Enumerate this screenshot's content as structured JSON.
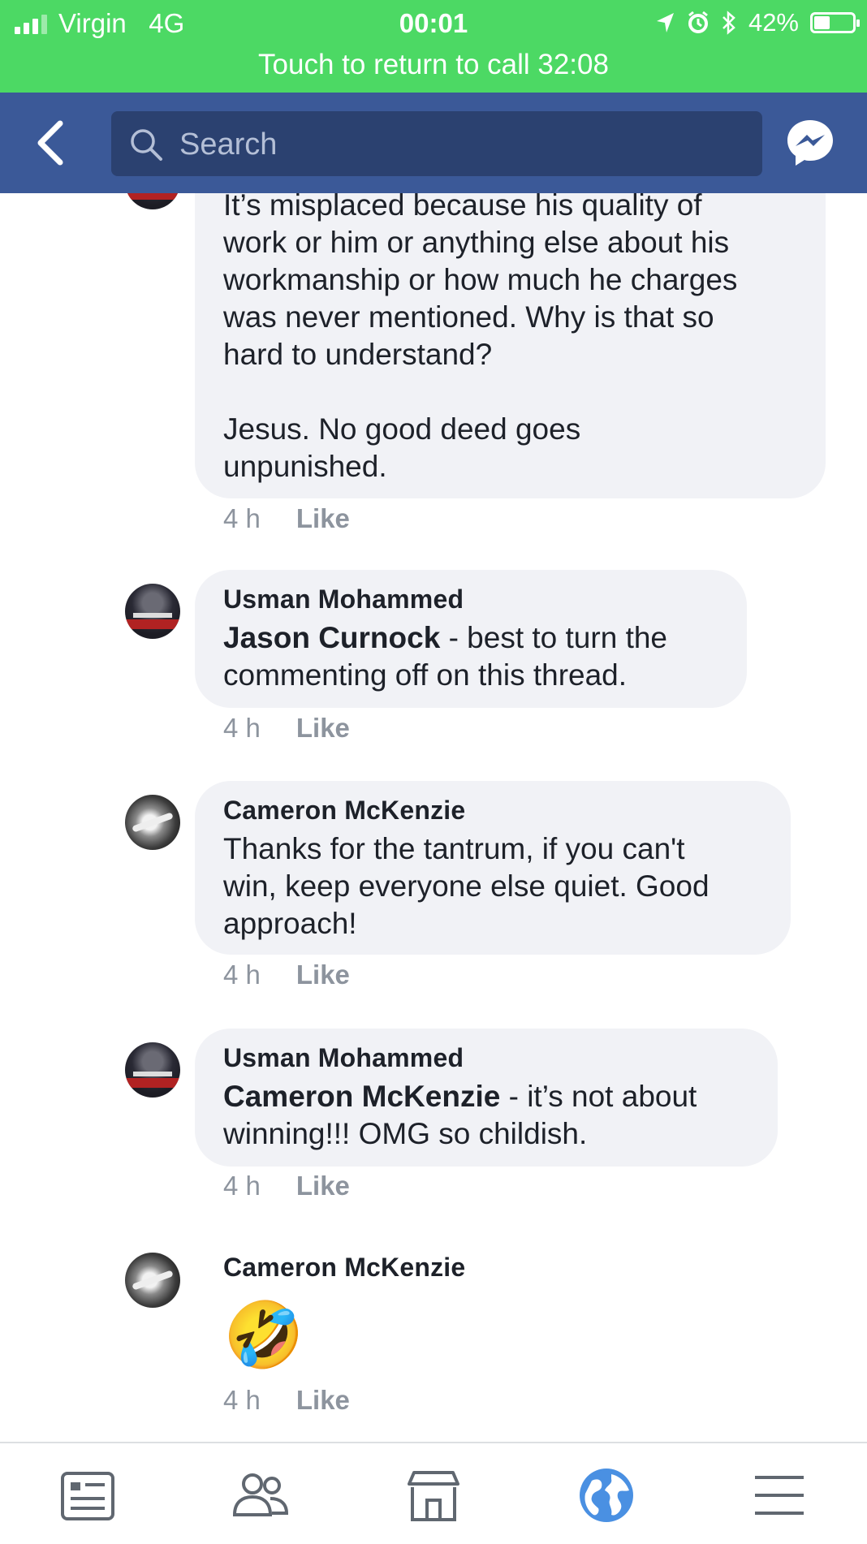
{
  "status_bar": {
    "carrier": "Virgin",
    "network": "4G",
    "time": "00:01",
    "battery": "42%",
    "battery_level": 0.42,
    "call_banner": "Touch to return to call 32:08",
    "icons": [
      "signal-icon",
      "location-arrow-icon",
      "alarm-icon",
      "bluetooth-icon",
      "battery-icon"
    ]
  },
  "nav": {
    "back_icon": "chevron-left-icon",
    "search_placeholder": "Search",
    "messenger_icon": "messenger-icon"
  },
  "comments": [
    {
      "author": "",
      "lines": [
        "It’s misplaced because his quality of",
        "work or him or anything else about his",
        "workmanship or how much he charges",
        "was never mentioned. Why is that so",
        "hard to understand?",
        "",
        "Jesus. No good deed goes",
        "unpunished."
      ],
      "time": "4 h",
      "like": "Like"
    },
    {
      "author": "Usman Mohammed",
      "mention": "Jason Curnock",
      "text_first": " - best to turn the",
      "text_rest": "commenting off on this thread.",
      "time": "4 h",
      "like": "Like"
    },
    {
      "author": "Cameron McKenzie",
      "lines": [
        "Thanks for the tantrum, if you can't",
        "win, keep everyone else quiet. Good",
        "approach!"
      ],
      "time": "4 h",
      "like": "Like"
    },
    {
      "author": "Usman Mohammed",
      "mention": "Cameron McKenzie",
      "text_first": " - it’s not about",
      "text_rest": "winning!!! OMG so childish.",
      "time": "4 h",
      "like": "Like"
    },
    {
      "author": "Cameron McKenzie",
      "emoji": "🤣",
      "time": "4 h",
      "like": "Like"
    }
  ],
  "tab_bar": {
    "tabs": [
      "news-feed-icon",
      "friends-icon",
      "marketplace-icon",
      "notifications-globe-icon",
      "menu-icon"
    ],
    "active_tab": "notifications-globe-icon",
    "accent": "#4a90e2"
  },
  "colors": {
    "status_green": "#4cd964",
    "nav_blue": "#3b5998",
    "bubble": "#f1f2f6",
    "meta_gray": "#8d949e"
  }
}
